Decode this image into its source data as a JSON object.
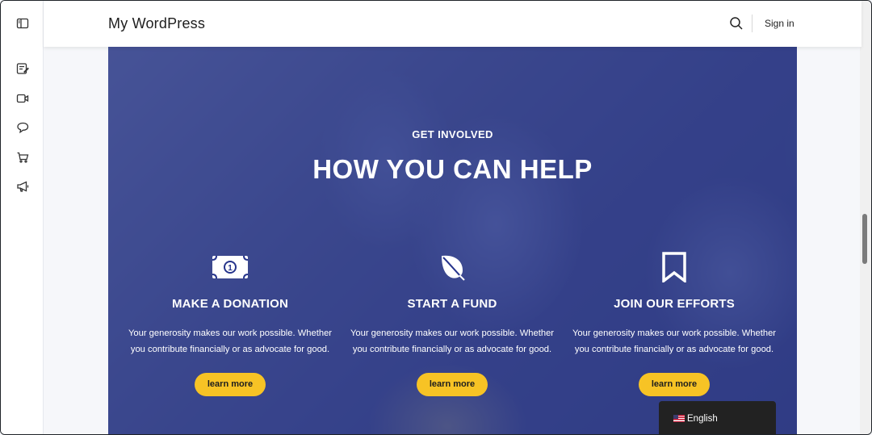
{
  "site": {
    "title": "My WordPress",
    "signin_label": "Sign in"
  },
  "rail": {
    "icons": [
      "sidebar-toggle-icon",
      "notes-icon",
      "video-icon",
      "chat-icon",
      "cart-icon",
      "megaphone-icon"
    ]
  },
  "hero": {
    "eyebrow": "GET INVOLVED",
    "headline": "HOW YOU CAN HELP",
    "columns": [
      {
        "icon": "banknote-icon",
        "title": "MAKE A DONATION",
        "description": "Your generosity makes our work possible. Whether you contribute financially or as advocate for good.",
        "button": "learn more"
      },
      {
        "icon": "leaf-icon",
        "title": "START A FUND",
        "description": "Your generosity makes our work possible. Whether you contribute financially or as advocate for good.",
        "button": "learn more"
      },
      {
        "icon": "bookmark-icon",
        "title": "JOIN OUR EFFORTS",
        "description": "Your generosity makes our work possible. Whether you contribute financially or as advocate for good.",
        "button": "learn more"
      }
    ]
  },
  "language": {
    "label": "English",
    "flag": "us-flag-icon"
  },
  "colors": {
    "overlay": "#26348c",
    "button": "#f7c325",
    "lang_bg": "#222222"
  }
}
